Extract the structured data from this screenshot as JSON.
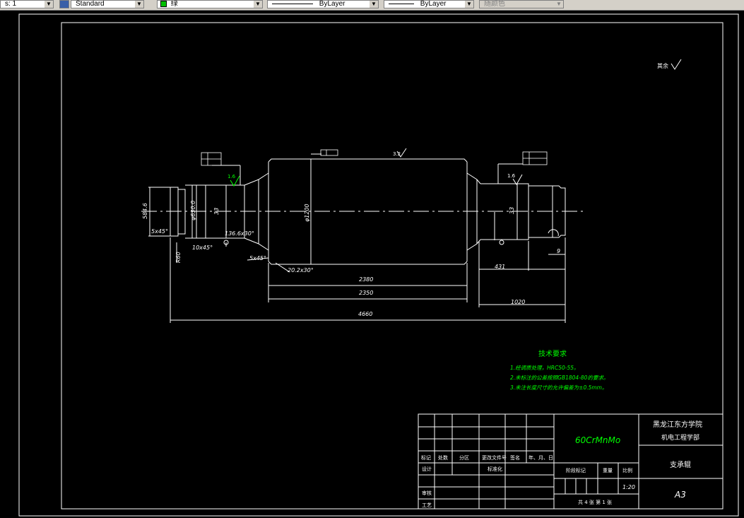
{
  "toolbar": {
    "scale_value": "s: 1",
    "text_style": "Standard",
    "color": "绿",
    "linetype": "ByLayer",
    "lineweight": "ByLayer",
    "plot_style": "随颜色"
  },
  "drawing": {
    "roughness_other": "其余",
    "roughness_main": "3.2",
    "roughness_left": "1.6",
    "roughness_right": "1.6",
    "dims": {
      "d_left_neck": "584.6",
      "chamfer_left": "5x45°",
      "chamfer_left2": "10x45°",
      "radius_left": "R60",
      "d_journal_left": "φ630.0",
      "len_33_left": "33",
      "taper_left": "136.6x30°",
      "chamfer_mid": "5x45°",
      "taper_mid": "20.2x30°",
      "d_body": "φ1200",
      "len_2380": "2380",
      "len_2350": "2350",
      "len_4660": "4660",
      "len_431": "431",
      "len_1020": "1020",
      "len_9": "9",
      "len_33_right": "33"
    }
  },
  "tech_requirements": {
    "title": "技术要求",
    "items": [
      "1.经调质处理，HRC50-55。",
      "2.未标注的公差按照GB1804-80的要求。",
      "3.未注长度尺寸的允许偏差为±0.5mm。"
    ]
  },
  "title_block": {
    "material": "60CrMnMo",
    "school": "黑龙江东方学院",
    "department": "机电工程学部",
    "part_name": "支承辊",
    "format": "A3",
    "scale": "1:20",
    "sheets": "共 4 张  第 1 张",
    "labels": {
      "mark": "标记",
      "count": "处数",
      "zone": "分区",
      "change_doc": "更改文件号",
      "sign": "签名",
      "date": "年、月、日",
      "design": "设计",
      "standardize": "标准化",
      "stage_mark": "阶段标记",
      "weight": "重量",
      "ratio": "比例",
      "review": "审核",
      "process": "工艺"
    }
  }
}
